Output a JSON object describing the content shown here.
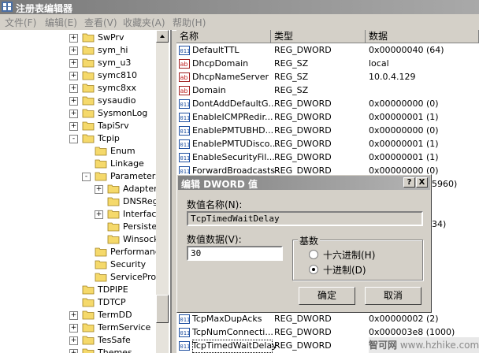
{
  "window": {
    "title": "注册表编辑器"
  },
  "menu": [
    "文件(F)",
    "编辑(E)",
    "查看(V)",
    "收藏夹(A)",
    "帮助(H)"
  ],
  "tree": {
    "items": [
      {
        "label": "SwPrv",
        "expander": "+"
      },
      {
        "label": "sym_hi",
        "expander": "+"
      },
      {
        "label": "sym_u3",
        "expander": "+"
      },
      {
        "label": "symc810",
        "expander": "+"
      },
      {
        "label": "symc8xx",
        "expander": "+"
      },
      {
        "label": "sysaudio",
        "expander": "+"
      },
      {
        "label": "SysmonLog",
        "expander": "+"
      },
      {
        "label": "TapiSrv",
        "expander": "+"
      },
      {
        "label": "Tcpip",
        "expander": "-"
      },
      {
        "label": "Enum",
        "expander": ""
      },
      {
        "label": "Linkage",
        "expander": ""
      },
      {
        "label": "Parameters",
        "expander": "-"
      },
      {
        "label": "Adapter",
        "expander": "+"
      },
      {
        "label": "DNSReg",
        "expander": ""
      },
      {
        "label": "Interfac",
        "expander": "+"
      },
      {
        "label": "Persiste",
        "expander": ""
      },
      {
        "label": "Winsock",
        "expander": ""
      },
      {
        "label": "Performance",
        "expander": ""
      },
      {
        "label": "Security",
        "expander": ""
      },
      {
        "label": "ServiceProv",
        "expander": ""
      },
      {
        "label": "TDPIPE",
        "expander": ""
      },
      {
        "label": "TDTCP",
        "expander": ""
      },
      {
        "label": "TermDD",
        "expander": "+"
      },
      {
        "label": "TermService",
        "expander": "+"
      },
      {
        "label": "TesSafe",
        "expander": "+"
      },
      {
        "label": "Themes",
        "expander": "+"
      }
    ]
  },
  "list": {
    "headers": [
      "名称",
      "类型",
      "数据"
    ],
    "rows": [
      {
        "icon": "dword",
        "name": "DefaultTTL",
        "type": "REG_DWORD",
        "data": "0x00000040 (64)"
      },
      {
        "icon": "string",
        "name": "DhcpDomain",
        "type": "REG_SZ",
        "data": "local"
      },
      {
        "icon": "string",
        "name": "DhcpNameServer",
        "type": "REG_SZ",
        "data": "10.0.4.129"
      },
      {
        "icon": "string",
        "name": "Domain",
        "type": "REG_SZ",
        "data": ""
      },
      {
        "icon": "dword",
        "name": "DontAddDefaultG...",
        "type": "REG_DWORD",
        "data": "0x00000000 (0)"
      },
      {
        "icon": "dword",
        "name": "EnableICMPRedir...",
        "type": "REG_DWORD",
        "data": "0x00000001 (1)"
      },
      {
        "icon": "dword",
        "name": "EnablePMTUBHD...",
        "type": "REG_DWORD",
        "data": "0x00000000 (0)"
      },
      {
        "icon": "dword",
        "name": "EnablePMTUDisco...",
        "type": "REG_DWORD",
        "data": "0x00000001 (1)"
      },
      {
        "icon": "dword",
        "name": "EnableSecurityFil...",
        "type": "REG_DWORD",
        "data": "0x00000001 (1)"
      },
      {
        "icon": "dword",
        "name": "ForwardBroadcasts",
        "type": "REG_DWORD",
        "data": "0x00000000 (0)"
      }
    ],
    "partial_data_fragments": [
      "5960)",
      "34)"
    ],
    "bottom_rows": [
      {
        "icon": "dword",
        "name": "TcpMaxDupAcks",
        "type": "REG_DWORD",
        "data": "0x00000002 (2)"
      },
      {
        "icon": "dword",
        "name": "TcpNumConnecti...",
        "type": "REG_DWORD",
        "data": "0x000003e8 (1000)"
      },
      {
        "icon": "dword",
        "name": "TcpTimedWaitDelay",
        "type": "REG_DWORD",
        "data": ""
      }
    ]
  },
  "dialog": {
    "title": "编辑 DWORD 值",
    "help_button": "?",
    "close_button": "X",
    "value_name_label": "数值名称(N):",
    "value_name": "TcpTimedWaitDelay",
    "value_data_label": "数值数据(V):",
    "value_data": "30",
    "base_group": "基数",
    "radio_hex": "十六进制(H)",
    "radio_dec": "十进制(D)",
    "selected_base": "dec",
    "ok": "确定",
    "cancel": "取消"
  },
  "watermark": {
    "main": "智可网",
    "url": "www.hzhike.com"
  }
}
